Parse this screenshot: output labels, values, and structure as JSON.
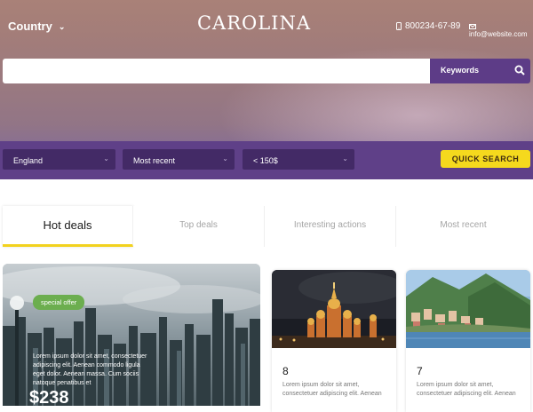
{
  "header": {
    "country_label": "Country",
    "brand": "CAROLINA",
    "phone": "800234-67-89",
    "email": "info@website.com"
  },
  "search": {
    "value": "",
    "placeholder": "",
    "category_label": "Keywords"
  },
  "filters": {
    "location": "England",
    "sort": "Most recent",
    "price": "< 150$",
    "quick_search_label": "QUICK SEARCH"
  },
  "tabs": [
    {
      "label": "Hot deals",
      "active": true
    },
    {
      "label": "Top deals",
      "active": false
    },
    {
      "label": "Interesting actions",
      "active": false
    },
    {
      "label": "Most recent",
      "active": false
    }
  ],
  "featured": {
    "badge": "special offer",
    "text": "Lorem ipsum dolor sit amet, consectetuer adipiscing elit. Aenean commodo ligula eget dolor. Aenean massa. Cum sociis natoque penatibus et",
    "price": "$238"
  },
  "cards": [
    {
      "number": "8",
      "text": "Lorem ipsum dolor sit amet, consectetuer adipiscing elit. Aenean"
    },
    {
      "number": "7",
      "text": "Lorem ipsum dolor sit amet, consectetuer adipiscing elit. Aenean"
    }
  ],
  "colors": {
    "purple": "#5f4088",
    "purple_dark": "#432a66",
    "yellow": "#f5d91d",
    "green": "#6cae4f"
  },
  "icons": {
    "phone": "phone-icon",
    "email": "envelope-icon",
    "search": "search-icon",
    "dropdown": "chevron-down-icon"
  }
}
